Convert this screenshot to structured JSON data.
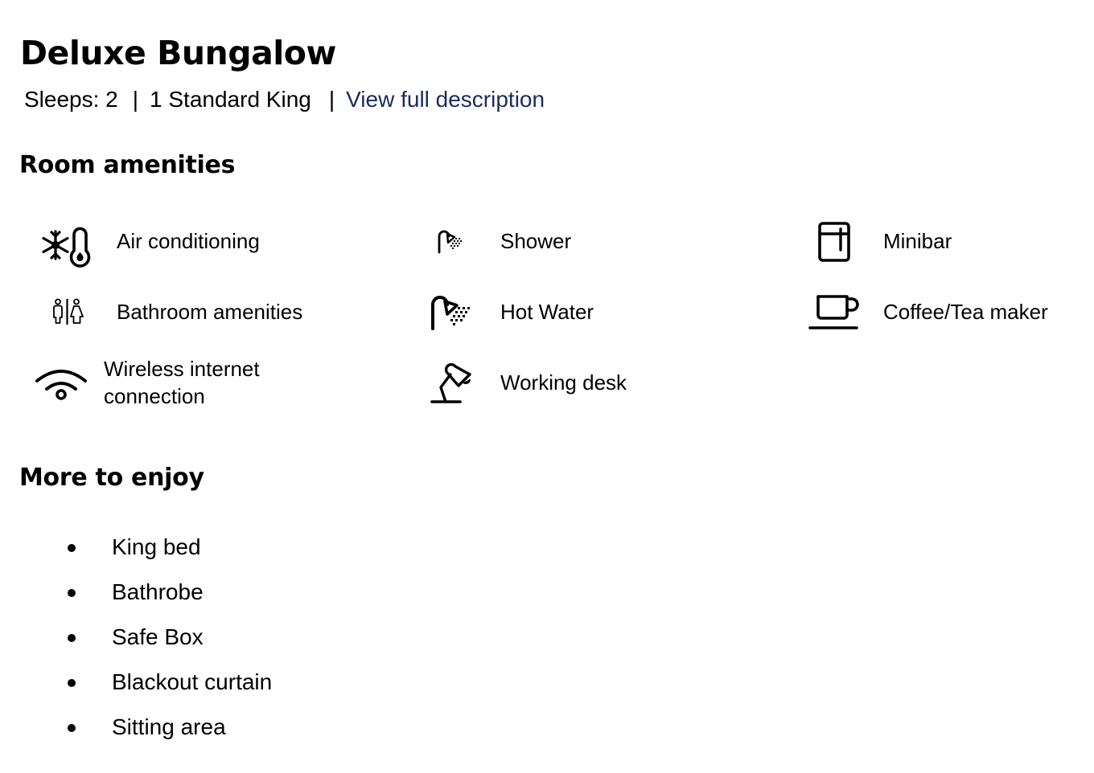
{
  "room": {
    "title": "Deluxe Bungalow",
    "sleeps": "Sleeps: 2",
    "separator": "|",
    "bed": "1 Standard King",
    "description_link": "View full description",
    "link_color": "#1a2b5e"
  },
  "amenities": {
    "heading": "Room amenities",
    "items": [
      {
        "label": "Air conditioning",
        "icon": "air-conditioning-icon"
      },
      {
        "label": "Shower",
        "icon": "shower-icon"
      },
      {
        "label": "Minibar",
        "icon": "minibar-icon"
      },
      {
        "label": "Bathroom amenities",
        "icon": "restroom-icon"
      },
      {
        "label": "Hot Water",
        "icon": "hot-water-icon"
      },
      {
        "label": "Coffee/Tea maker",
        "icon": "coffee-cup-icon"
      },
      {
        "label": "Wireless internet connection",
        "label_line1": "Wireless internet",
        "label_line2": "connection",
        "icon": "wifi-icon"
      },
      {
        "label": "Working desk",
        "icon": "desk-lamp-icon"
      }
    ]
  },
  "enjoy": {
    "heading": "More to enjoy",
    "items": [
      "King bed",
      "Bathrobe",
      "Safe Box",
      "Blackout curtain",
      "Sitting area"
    ]
  }
}
